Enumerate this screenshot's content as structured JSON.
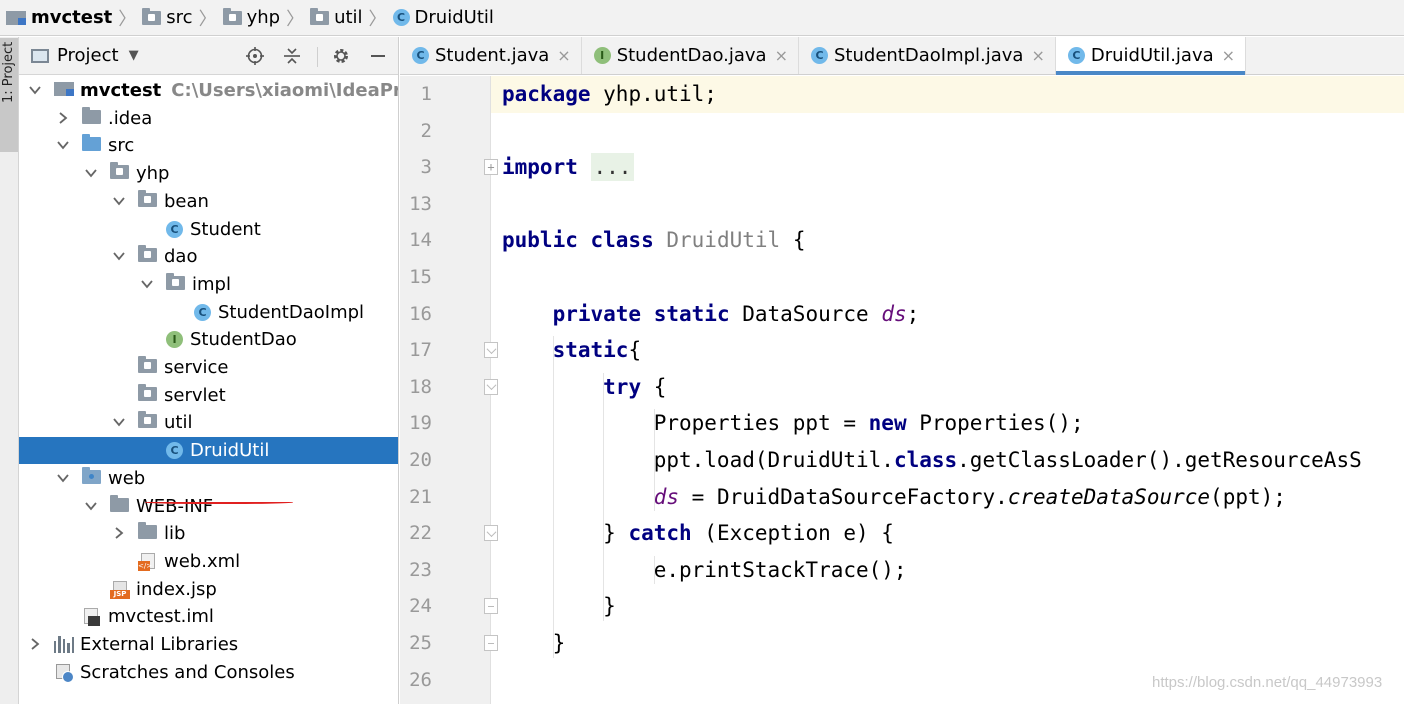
{
  "breadcrumb": [
    {
      "label": "mvctest",
      "icon": "module-icon",
      "bold": true
    },
    {
      "label": "src",
      "icon": "folder-icon"
    },
    {
      "label": "yhp",
      "icon": "folder-icon"
    },
    {
      "label": "util",
      "icon": "folder-icon"
    },
    {
      "label": "DruidUtil",
      "icon": "class-icon"
    }
  ],
  "side_stripe": {
    "tab_label": "1: Project"
  },
  "project_panel": {
    "title": "Project",
    "tools": [
      "target-icon",
      "collapse-all-icon",
      "gear-icon",
      "minimize-icon"
    ],
    "tree": [
      {
        "label": "mvctest",
        "hint": "C:\\Users\\xiaomi\\IdeaProjects",
        "icon": "module",
        "expanded": true,
        "bold": true
      },
      {
        "label": ".idea",
        "icon": "folder",
        "expanded": false
      },
      {
        "label": "src",
        "icon": "folder-src",
        "expanded": true
      },
      {
        "label": "yhp",
        "icon": "package",
        "expanded": true
      },
      {
        "label": "bean",
        "icon": "package",
        "expanded": true
      },
      {
        "label": "Student",
        "icon": "class"
      },
      {
        "label": "dao",
        "icon": "package",
        "expanded": true
      },
      {
        "label": "impl",
        "icon": "package",
        "expanded": true
      },
      {
        "label": "StudentDaoImpl",
        "icon": "class"
      },
      {
        "label": "StudentDao",
        "icon": "interface"
      },
      {
        "label": "service",
        "icon": "package"
      },
      {
        "label": "servlet",
        "icon": "package"
      },
      {
        "label": "util",
        "icon": "package",
        "expanded": true
      },
      {
        "label": "DruidUtil",
        "icon": "class",
        "selected": true
      },
      {
        "label": "web",
        "icon": "folder-web",
        "expanded": true
      },
      {
        "label": "WEB-INF",
        "icon": "folder",
        "expanded": true
      },
      {
        "label": "lib",
        "icon": "folder",
        "expanded": false
      },
      {
        "label": "web.xml",
        "icon": "xml"
      },
      {
        "label": "index.jsp",
        "icon": "jsp"
      },
      {
        "label": "mvctest.iml",
        "icon": "iml"
      },
      {
        "label": "External Libraries",
        "icon": "library",
        "expanded": false
      },
      {
        "label": "Scratches and Consoles",
        "icon": "scratch"
      }
    ]
  },
  "tabs": [
    {
      "label": "Student.java",
      "kind": "class",
      "active": false
    },
    {
      "label": "StudentDao.java",
      "kind": "interface",
      "active": false
    },
    {
      "label": "StudentDaoImpl.java",
      "kind": "class",
      "active": false
    },
    {
      "label": "DruidUtil.java",
      "kind": "class",
      "active": true
    }
  ],
  "tab_close_glyph": "×",
  "editor": {
    "lines": [
      {
        "num": "1",
        "tokens": [
          {
            "t": "package",
            "c": "kw"
          },
          {
            "t": " yhp.util;",
            "c": "plain"
          }
        ]
      },
      {
        "num": "2",
        "tokens": []
      },
      {
        "num": "3",
        "tokens": [
          {
            "t": "import",
            "c": "kw"
          },
          {
            "t": " ",
            "c": "plain"
          },
          {
            "t": "...",
            "c": "ellipsis"
          }
        ]
      },
      {
        "num": "13",
        "tokens": []
      },
      {
        "num": "14",
        "tokens": [
          {
            "t": "public class",
            "c": "kw"
          },
          {
            "t": " ",
            "c": "plain"
          },
          {
            "t": "DruidUtil",
            "c": "cls"
          },
          {
            "t": " {",
            "c": "plain"
          }
        ]
      },
      {
        "num": "15",
        "tokens": []
      },
      {
        "num": "16",
        "tokens": [
          {
            "t": "    ",
            "c": "plain"
          },
          {
            "t": "private static",
            "c": "kw"
          },
          {
            "t": " DataSource ",
            "c": "plain"
          },
          {
            "t": "ds",
            "c": "fld"
          },
          {
            "t": ";",
            "c": "plain"
          }
        ]
      },
      {
        "num": "17",
        "tokens": [
          {
            "t": "    ",
            "c": "plain"
          },
          {
            "t": "static",
            "c": "kw"
          },
          {
            "t": "{",
            "c": "plain"
          }
        ]
      },
      {
        "num": "18",
        "tokens": [
          {
            "t": "        ",
            "c": "plain"
          },
          {
            "t": "try",
            "c": "kw"
          },
          {
            "t": " {",
            "c": "plain"
          }
        ]
      },
      {
        "num": "19",
        "tokens": [
          {
            "t": "            Properties ppt = ",
            "c": "plain"
          },
          {
            "t": "new",
            "c": "kw"
          },
          {
            "t": " Properties();",
            "c": "plain"
          }
        ]
      },
      {
        "num": "20",
        "tokens": [
          {
            "t": "            ppt.load(DruidUtil.",
            "c": "plain"
          },
          {
            "t": "class",
            "c": "kw"
          },
          {
            "t": ".getClassLoader().getResourceAsS",
            "c": "plain"
          }
        ]
      },
      {
        "num": "21",
        "tokens": [
          {
            "t": "            ",
            "c": "plain"
          },
          {
            "t": "ds",
            "c": "fld"
          },
          {
            "t": " = DruidDataSourceFactory.",
            "c": "plain"
          },
          {
            "t": "createDataSource",
            "c": "mth"
          },
          {
            "t": "(ppt);",
            "c": "plain"
          }
        ]
      },
      {
        "num": "22",
        "tokens": [
          {
            "t": "        } ",
            "c": "plain"
          },
          {
            "t": "catch",
            "c": "kw"
          },
          {
            "t": " (Exception e) {",
            "c": "plain"
          }
        ]
      },
      {
        "num": "23",
        "tokens": [
          {
            "t": "            e.printStackTrace();",
            "c": "plain"
          }
        ]
      },
      {
        "num": "24",
        "tokens": [
          {
            "t": "        }",
            "c": "plain"
          }
        ]
      },
      {
        "num": "25",
        "tokens": [
          {
            "t": "    }",
            "c": "plain"
          }
        ]
      },
      {
        "num": "26",
        "tokens": []
      }
    ]
  },
  "watermark": "https://blog.csdn.net/qq_44973993",
  "colors": {
    "selection": "#2675bf",
    "keyword": "#000080",
    "field": "#660e7a",
    "current_line": "#fdf9e6",
    "active_tab_underline": "#4a88c7"
  }
}
